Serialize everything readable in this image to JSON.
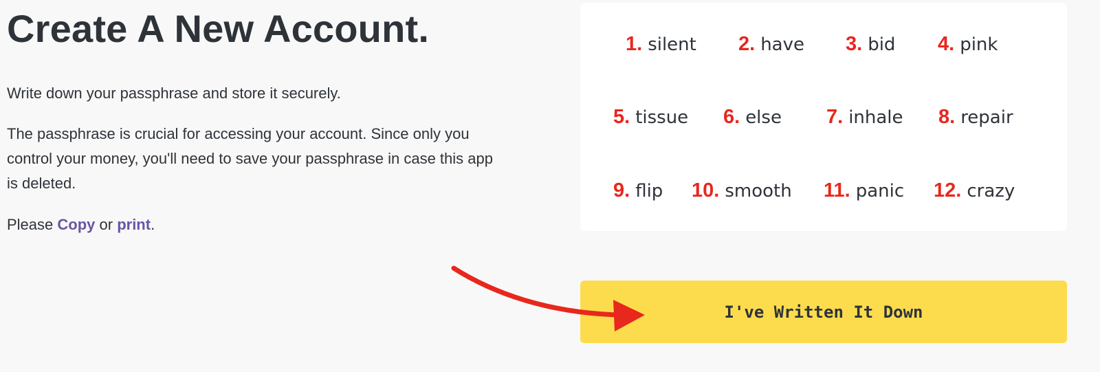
{
  "header": {
    "title": "Create A New Account."
  },
  "instructions": {
    "line1": "Write down your passphrase and store it securely.",
    "line2": "The passphrase is crucial for accessing your account. Since only you control your money, you'll need to save your passphrase in case this app is deleted.",
    "line3_prefix": "Please ",
    "copy_link": "Copy",
    "line3_middle": " or ",
    "print_link": "print",
    "line3_suffix": "."
  },
  "passphrase": {
    "words": [
      {
        "num": "1.",
        "word": "silent"
      },
      {
        "num": "2.",
        "word": "have"
      },
      {
        "num": "3.",
        "word": "bid"
      },
      {
        "num": "4.",
        "word": "pink"
      },
      {
        "num": "5.",
        "word": "tissue"
      },
      {
        "num": "6.",
        "word": "else"
      },
      {
        "num": "7.",
        "word": "inhale"
      },
      {
        "num": "8.",
        "word": "repair"
      },
      {
        "num": "9.",
        "word": "flip"
      },
      {
        "num": "10.",
        "word": "smooth"
      },
      {
        "num": "11.",
        "word": "panic"
      },
      {
        "num": "12.",
        "word": "crazy"
      }
    ]
  },
  "actions": {
    "confirm_label": "I've Written It Down"
  },
  "colors": {
    "accent_link": "#6a55a4",
    "annotation_red": "#e8271d",
    "button_yellow": "#fcdc4d"
  },
  "icons": {
    "annotation": "red-arrow-icon"
  }
}
